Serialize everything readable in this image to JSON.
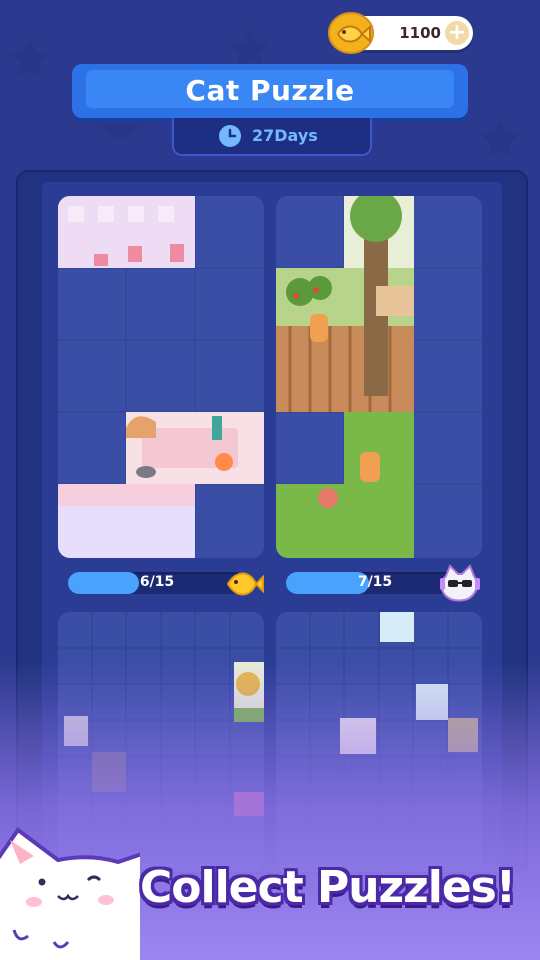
{
  "coins": {
    "amount": "1100",
    "plus_label": "+"
  },
  "header": {
    "title": "Cat Puzzle",
    "days": "27Days"
  },
  "puzzles": [
    {
      "progress_text": "6/15",
      "progress": 0.4,
      "reward_icon": "fish-icon"
    },
    {
      "progress_text": "7/15",
      "progress": 0.4667,
      "reward_icon": "cat-sunglasses-icon"
    }
  ],
  "caption": "Collect Puzzles!",
  "colors": {
    "background": "#2b3a8e",
    "banner": "#3a86f5",
    "progress_fill": "#4aa2ff",
    "caption_outline": "#4a2aa8"
  }
}
